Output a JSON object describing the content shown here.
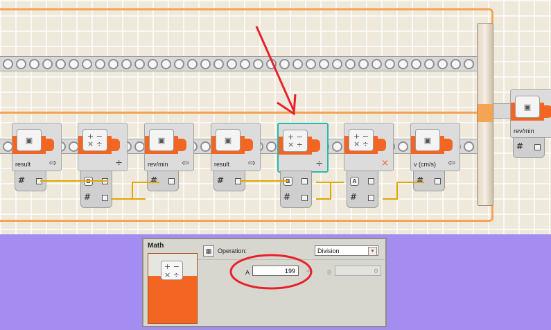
{
  "canvas": {
    "blocks": [
      {
        "label": "result",
        "icon": "variable-briefcase-icon",
        "kind": "variable",
        "sub_icon": "write-arrow-icon",
        "sub_glyph": "⇨",
        "plug_glyph": "#"
      },
      {
        "label": "",
        "icon": "math-icon",
        "kind": "math",
        "sub_icon": "division-icon",
        "sub_glyph": "÷",
        "plug_letter": "B",
        "plug_glyph": "#"
      },
      {
        "label": "rev/min",
        "icon": "variable-briefcase-icon",
        "kind": "variable",
        "sub_icon": "read-arrow-icon",
        "sub_glyph": "⇦",
        "plug_glyph": "#"
      },
      {
        "label": "result",
        "icon": "variable-briefcase-icon",
        "kind": "variable",
        "sub_icon": "write-arrow-icon",
        "sub_glyph": "⇨",
        "plug_glyph": "#"
      },
      {
        "label": "",
        "icon": "math-icon",
        "kind": "math",
        "sub_icon": "division-icon",
        "sub_glyph": "÷",
        "plug_letter": "B",
        "plug_glyph": "#",
        "selected": true
      },
      {
        "label": "",
        "icon": "math-icon",
        "kind": "math",
        "sub_icon": "multiply-icon",
        "sub_glyph": "×",
        "plug_letter": "A",
        "plug_glyph": "#"
      },
      {
        "label": "v (cm/s)",
        "icon": "variable-briefcase-icon",
        "kind": "variable",
        "sub_icon": "read-arrow-icon",
        "sub_glyph": "⇦",
        "plug_glyph": "#"
      }
    ],
    "side_block": {
      "label": "rev/min",
      "plug_glyph": "#"
    },
    "annotation_color": "#e8202a"
  },
  "panel": {
    "title": "Math",
    "operation_label": "Operation:",
    "operation_value": "Division",
    "a_label": "A",
    "a_value": "199",
    "operator_symbol": "÷",
    "b_label": "B",
    "b_value": "0",
    "accent_color": "#f26522"
  }
}
